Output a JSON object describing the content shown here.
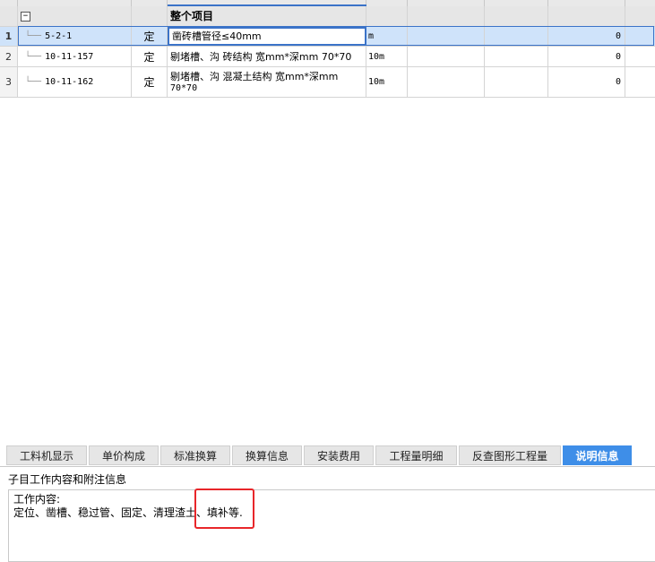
{
  "grid": {
    "group_row": {
      "title": "整个项目",
      "collapse_glyph": "−"
    },
    "rows": [
      {
        "num": "1",
        "code": "5-2-1",
        "category": "定",
        "name": "凿砖槽管径≤40mm",
        "unit": "m",
        "value": "0"
      },
      {
        "num": "2",
        "code": "10-11-157",
        "category": "定",
        "name": "剔堵槽、沟 砖结构 宽mm*深mm 70*70",
        "unit": "10m",
        "value": "0"
      },
      {
        "num": "3",
        "code": "10-11-162",
        "category": "定",
        "name_line1": "剔堵槽、沟 混凝土结构 宽mm*深mm",
        "name_line2": "70*70",
        "unit": "10m",
        "value": "0"
      }
    ],
    "tree_glyph": "└──"
  },
  "tabs": [
    {
      "label": "工料机显示",
      "active": false
    },
    {
      "label": "单价构成",
      "active": false
    },
    {
      "label": "标准换算",
      "active": false
    },
    {
      "label": "换算信息",
      "active": false
    },
    {
      "label": "安装费用",
      "active": false
    },
    {
      "label": "工程量明细",
      "active": false
    },
    {
      "label": "反查图形工程量",
      "active": false
    },
    {
      "label": "说明信息",
      "active": true
    }
  ],
  "info": {
    "section_title": "子目工作内容和附注信息",
    "content_heading": "工作内容:",
    "content_body": "定位、凿槽、稳过管、固定、清理渣土、填补等."
  },
  "colors": {
    "selection": "#cfe3fa",
    "accent_blue": "#3e8ee8",
    "highlight_red": "#e8262a"
  }
}
